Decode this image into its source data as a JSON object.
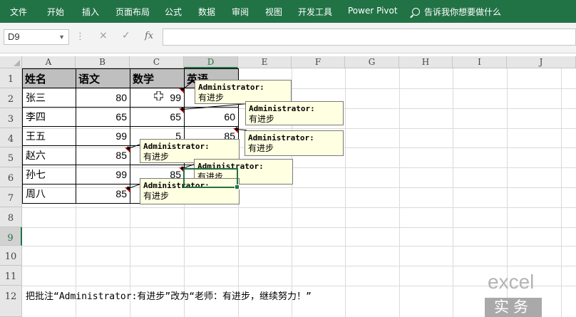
{
  "ribbon": {
    "tabs": [
      "文件",
      "开始",
      "插入",
      "页面布局",
      "公式",
      "数据",
      "审阅",
      "视图",
      "开发工具",
      "Power Pivot"
    ],
    "search_text": "告诉我你想要做什么"
  },
  "formula_bar": {
    "name_box": "D9",
    "fx_label": "fx",
    "cancel_glyph": "×",
    "enter_glyph": "✓",
    "separator_glyph": "⋮",
    "dropdown_glyph": "▼",
    "formula": ""
  },
  "grid": {
    "columns": [
      "A",
      "B",
      "C",
      "D",
      "E",
      "F",
      "G",
      "H",
      "I",
      "J"
    ],
    "rows": [
      "1",
      "2",
      "3",
      "4",
      "5",
      "6",
      "7",
      "8",
      "9",
      "10",
      "11",
      "12"
    ],
    "selected_cell": "D9"
  },
  "table": {
    "headers": [
      "姓名",
      "语文",
      "数学",
      "英语"
    ],
    "rows": [
      [
        "张三",
        "80",
        "99",
        ""
      ],
      [
        "李四",
        "65",
        "65",
        "60"
      ],
      [
        "王五",
        "99",
        "5",
        "85"
      ],
      [
        "赵六",
        "85",
        "",
        ""
      ],
      [
        "孙七",
        "99",
        "85",
        ""
      ],
      [
        "周八",
        "85",
        "",
        ""
      ]
    ]
  },
  "comments": [
    {
      "author": "Administrator:",
      "text": "有进步"
    },
    {
      "author": "Administrator:",
      "text": "有进步"
    },
    {
      "author": "Administrator:",
      "text": "有进步"
    },
    {
      "author": "Administrator:",
      "text": "有进步"
    },
    {
      "author": "Administrator:",
      "text": "有进步"
    },
    {
      "author": "Administrator:",
      "text": "有进步"
    }
  ],
  "caption": "把批注“Administrator:有进步”改为“老师：有进步，继续努力！”",
  "watermark": {
    "line1": "excel",
    "line2": "实务"
  },
  "colors": {
    "ribbon": "#217346",
    "header_fill": "#bfbfbf",
    "comment_fill": "#ffffe1",
    "comment_indicator": "#e00000"
  }
}
